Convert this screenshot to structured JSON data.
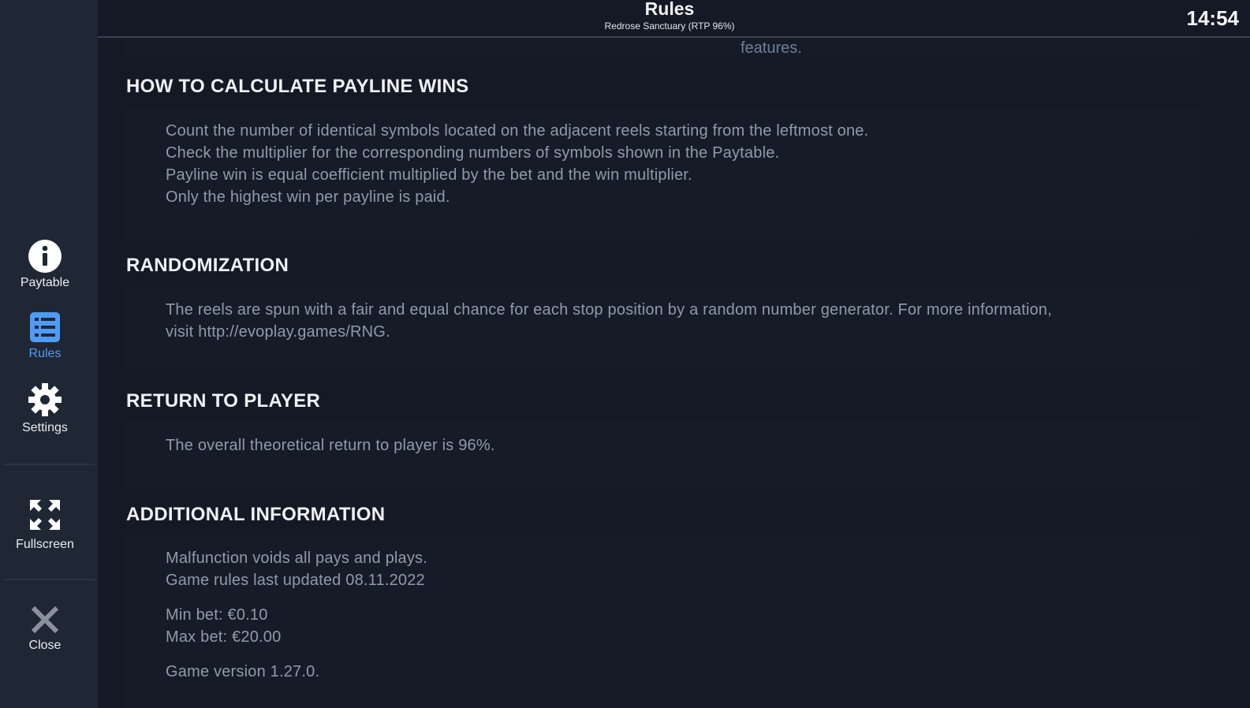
{
  "header": {
    "title": "Rules",
    "subtitle": "Redrose Sanctuary (RTP 96%)",
    "clock": "14:54"
  },
  "sidebar": {
    "paytable": "Paytable",
    "rules": "Rules",
    "settings": "Settings",
    "fullscreen": "Fullscreen",
    "close": "Close"
  },
  "content": {
    "cutoff_text": "features.",
    "payline": {
      "title": "HOW TO CALCULATE PAYLINE WINS",
      "lines": [
        "Count the number of identical symbols located on the adjacent reels starting from the leftmost one.",
        "Check the multiplier for the corresponding numbers of symbols shown in the Paytable.",
        "Payline win is equal coefficient multiplied by the bet and the win multiplier.",
        "Only the highest win per payline is paid."
      ]
    },
    "randomization": {
      "title": "RANDOMIZATION",
      "lines": [
        "The reels are spun with a fair and equal chance for each stop position by a random number generator. For more information,",
        "visit http://evoplay.games/RNG."
      ]
    },
    "rtp": {
      "title": "RETURN TO PLAYER",
      "text": "The overall theoretical return to player is 96%."
    },
    "additional": {
      "title": "ADDITIONAL INFORMATION",
      "line1": "Malfunction voids all pays and plays.",
      "line2": "Game rules last updated 08.11.2022",
      "min_bet": "Min bet: €0.10",
      "max_bet": "Max bet: €20.00",
      "version": "Game version 1.27.0."
    }
  },
  "colors": {
    "accent": "#4f9cf2",
    "background": "#141a25",
    "sidebar": "#202734"
  }
}
